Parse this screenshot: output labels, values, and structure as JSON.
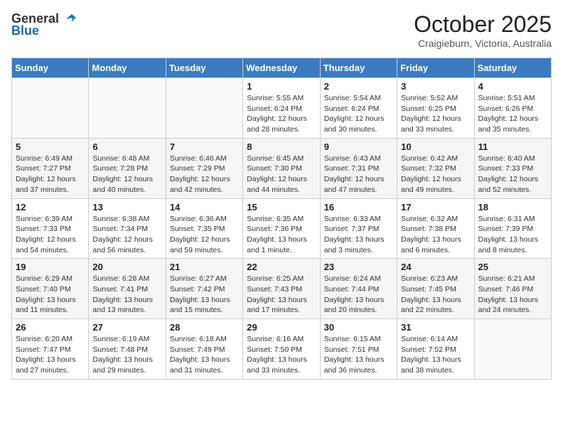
{
  "header": {
    "logo_general": "General",
    "logo_blue": "Blue",
    "month": "October 2025",
    "location": "Craigieburn, Victoria, Australia"
  },
  "days_of_week": [
    "Sunday",
    "Monday",
    "Tuesday",
    "Wednesday",
    "Thursday",
    "Friday",
    "Saturday"
  ],
  "weeks": [
    [
      {
        "day": "",
        "info": ""
      },
      {
        "day": "",
        "info": ""
      },
      {
        "day": "",
        "info": ""
      },
      {
        "day": "1",
        "info": "Sunrise: 5:55 AM\nSunset: 6:24 PM\nDaylight: 12 hours\nand 28 minutes."
      },
      {
        "day": "2",
        "info": "Sunrise: 5:54 AM\nSunset: 6:24 PM\nDaylight: 12 hours\nand 30 minutes."
      },
      {
        "day": "3",
        "info": "Sunrise: 5:52 AM\nSunset: 6:25 PM\nDaylight: 12 hours\nand 33 minutes."
      },
      {
        "day": "4",
        "info": "Sunrise: 5:51 AM\nSunset: 6:26 PM\nDaylight: 12 hours\nand 35 minutes."
      }
    ],
    [
      {
        "day": "5",
        "info": "Sunrise: 6:49 AM\nSunset: 7:27 PM\nDaylight: 12 hours\nand 37 minutes."
      },
      {
        "day": "6",
        "info": "Sunrise: 6:48 AM\nSunset: 7:28 PM\nDaylight: 12 hours\nand 40 minutes."
      },
      {
        "day": "7",
        "info": "Sunrise: 6:46 AM\nSunset: 7:29 PM\nDaylight: 12 hours\nand 42 minutes."
      },
      {
        "day": "8",
        "info": "Sunrise: 6:45 AM\nSunset: 7:30 PM\nDaylight: 12 hours\nand 44 minutes."
      },
      {
        "day": "9",
        "info": "Sunrise: 6:43 AM\nSunset: 7:31 PM\nDaylight: 12 hours\nand 47 minutes."
      },
      {
        "day": "10",
        "info": "Sunrise: 6:42 AM\nSunset: 7:32 PM\nDaylight: 12 hours\nand 49 minutes."
      },
      {
        "day": "11",
        "info": "Sunrise: 6:40 AM\nSunset: 7:33 PM\nDaylight: 12 hours\nand 52 minutes."
      }
    ],
    [
      {
        "day": "12",
        "info": "Sunrise: 6:39 AM\nSunset: 7:33 PM\nDaylight: 12 hours\nand 54 minutes."
      },
      {
        "day": "13",
        "info": "Sunrise: 6:38 AM\nSunset: 7:34 PM\nDaylight: 12 hours\nand 56 minutes."
      },
      {
        "day": "14",
        "info": "Sunrise: 6:36 AM\nSunset: 7:35 PM\nDaylight: 12 hours\nand 59 minutes."
      },
      {
        "day": "15",
        "info": "Sunrise: 6:35 AM\nSunset: 7:36 PM\nDaylight: 13 hours\nand 1 minute."
      },
      {
        "day": "16",
        "info": "Sunrise: 6:33 AM\nSunset: 7:37 PM\nDaylight: 13 hours\nand 3 minutes."
      },
      {
        "day": "17",
        "info": "Sunrise: 6:32 AM\nSunset: 7:38 PM\nDaylight: 13 hours\nand 6 minutes."
      },
      {
        "day": "18",
        "info": "Sunrise: 6:31 AM\nSunset: 7:39 PM\nDaylight: 13 hours\nand 8 minutes."
      }
    ],
    [
      {
        "day": "19",
        "info": "Sunrise: 6:29 AM\nSunset: 7:40 PM\nDaylight: 13 hours\nand 11 minutes."
      },
      {
        "day": "20",
        "info": "Sunrise: 6:28 AM\nSunset: 7:41 PM\nDaylight: 13 hours\nand 13 minutes."
      },
      {
        "day": "21",
        "info": "Sunrise: 6:27 AM\nSunset: 7:42 PM\nDaylight: 13 hours\nand 15 minutes."
      },
      {
        "day": "22",
        "info": "Sunrise: 6:25 AM\nSunset: 7:43 PM\nDaylight: 13 hours\nand 17 minutes."
      },
      {
        "day": "23",
        "info": "Sunrise: 6:24 AM\nSunset: 7:44 PM\nDaylight: 13 hours\nand 20 minutes."
      },
      {
        "day": "24",
        "info": "Sunrise: 6:23 AM\nSunset: 7:45 PM\nDaylight: 13 hours\nand 22 minutes."
      },
      {
        "day": "25",
        "info": "Sunrise: 6:21 AM\nSunset: 7:46 PM\nDaylight: 13 hours\nand 24 minutes."
      }
    ],
    [
      {
        "day": "26",
        "info": "Sunrise: 6:20 AM\nSunset: 7:47 PM\nDaylight: 13 hours\nand 27 minutes."
      },
      {
        "day": "27",
        "info": "Sunrise: 6:19 AM\nSunset: 7:48 PM\nDaylight: 13 hours\nand 29 minutes."
      },
      {
        "day": "28",
        "info": "Sunrise: 6:18 AM\nSunset: 7:49 PM\nDaylight: 13 hours\nand 31 minutes."
      },
      {
        "day": "29",
        "info": "Sunrise: 6:16 AM\nSunset: 7:50 PM\nDaylight: 13 hours\nand 33 minutes."
      },
      {
        "day": "30",
        "info": "Sunrise: 6:15 AM\nSunset: 7:51 PM\nDaylight: 13 hours\nand 36 minutes."
      },
      {
        "day": "31",
        "info": "Sunrise: 6:14 AM\nSunset: 7:52 PM\nDaylight: 13 hours\nand 38 minutes."
      },
      {
        "day": "",
        "info": ""
      }
    ]
  ]
}
